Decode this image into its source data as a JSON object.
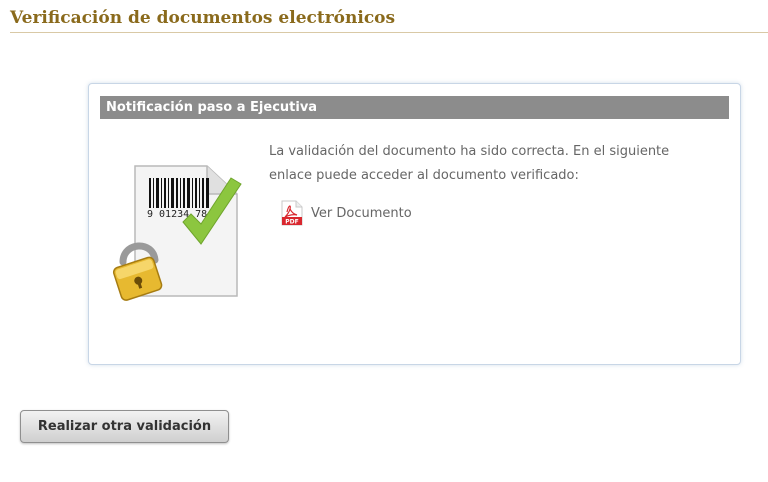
{
  "page": {
    "title": "Verificación de documentos electrónicos"
  },
  "panel": {
    "header": "Notificación paso a Ejecutiva",
    "message": "La validación del documento ha sido correcta. En el siguiente enlace puede acceder al documento verificado:",
    "illustration": {
      "icon": "verified-document-icon",
      "barcode_text": "9 01234 78"
    },
    "document_link": {
      "label": "Ver Documento",
      "icon": "pdf-icon",
      "icon_text": "PDF"
    }
  },
  "actions": {
    "revalidate_label": "Realizar otra validación"
  },
  "colors": {
    "title": "#8a6a1c",
    "panel_header_bg": "#8c8c8c",
    "check": "#8cc63f",
    "pdf_red": "#d9272e"
  }
}
